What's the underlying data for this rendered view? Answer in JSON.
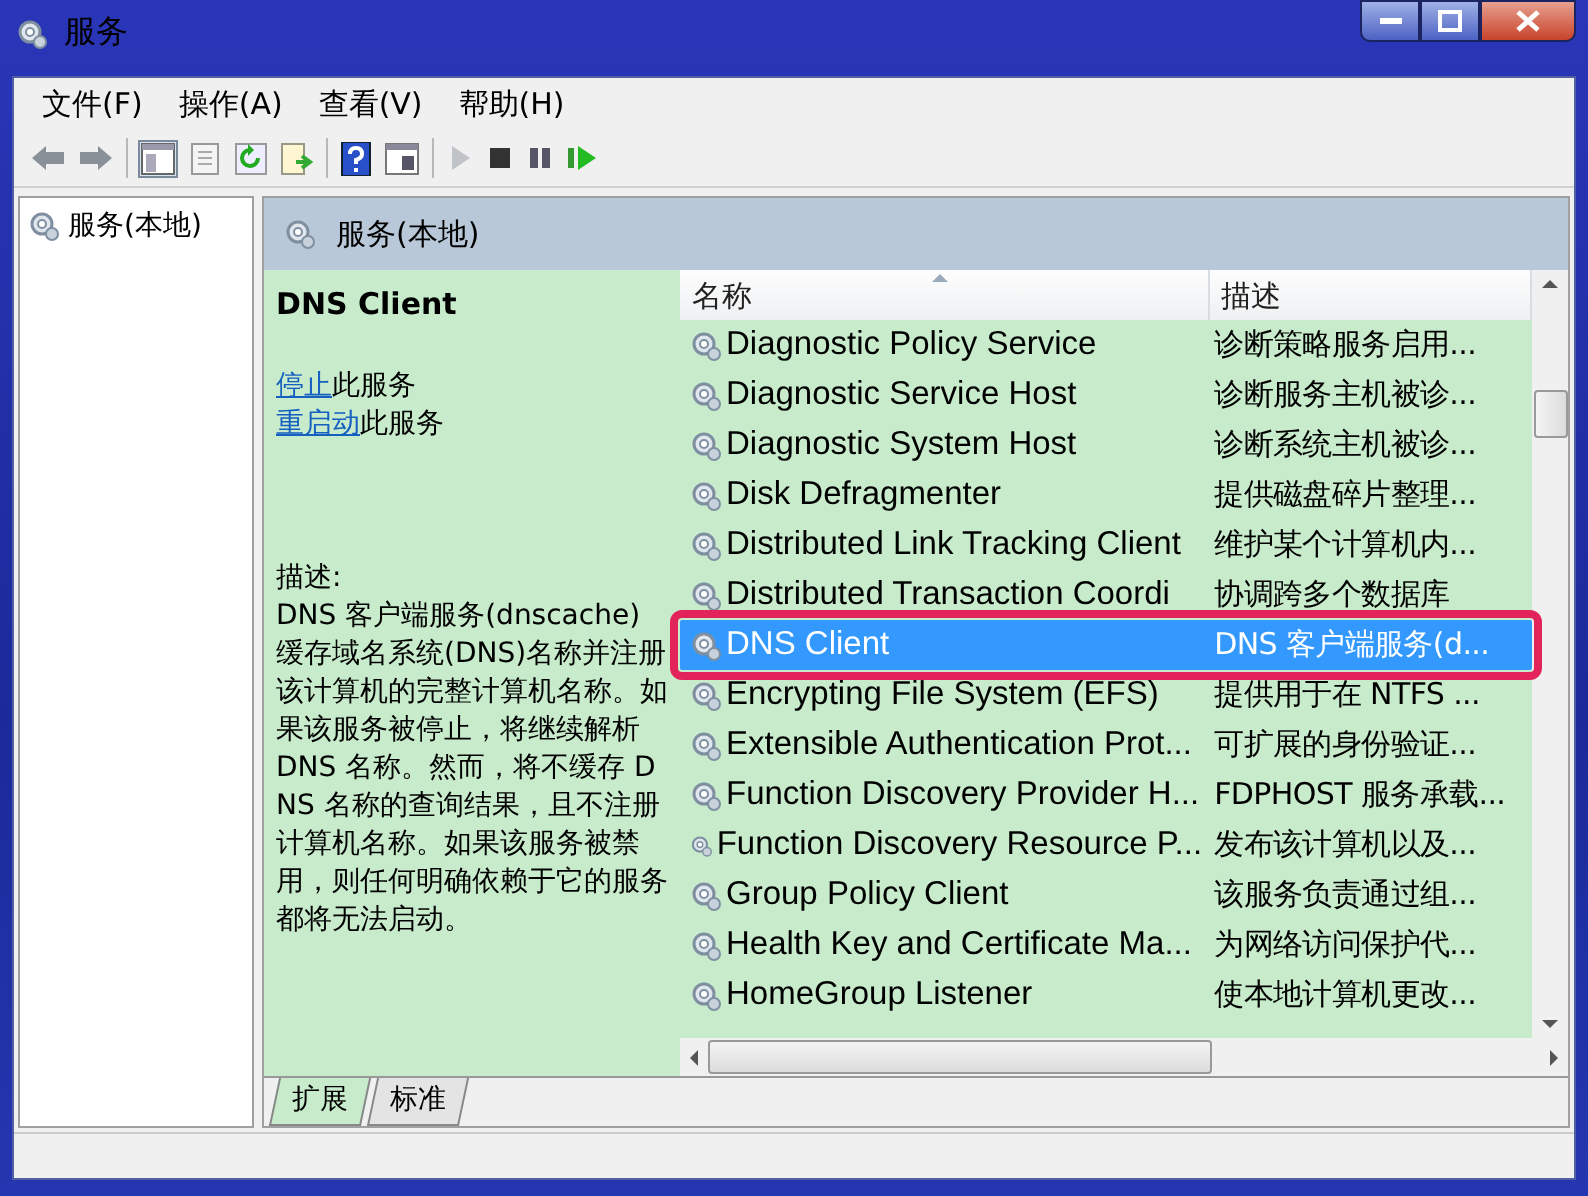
{
  "window": {
    "title": "服务"
  },
  "menu": [
    {
      "label": "文件(F)"
    },
    {
      "label": "操作(A)"
    },
    {
      "label": "查看(V)"
    },
    {
      "label": "帮助(H)"
    }
  ],
  "tree": {
    "items": [
      {
        "label": "服务(本地)",
        "selected": false
      }
    ]
  },
  "pane_header": {
    "title": "服务(本地)"
  },
  "detail": {
    "title": "DNS Client",
    "actions": [
      {
        "link": "停止",
        "text": "此服务"
      },
      {
        "link": "重启动",
        "text": "此服务"
      }
    ],
    "description_label": "描述:",
    "description": "DNS 客户端服务(dnscache)缓存域名系统(DNS)名称并注册该计算机的完整计算机名称。如果该服务被停止，将继续解析 DNS 名称。然而，将不缓存 DNS 名称的查询结果，且不注册计算机名称。如果该服务被禁用，则任何明确依赖于它的服务都将无法启动。"
  },
  "table": {
    "columns": [
      {
        "label": "名称",
        "sorted": true
      },
      {
        "label": "描述",
        "sorted": false
      }
    ],
    "rows": [
      {
        "name": "Diagnostic Policy Service",
        "description": "诊断策略服务启用...",
        "selected": false
      },
      {
        "name": "Diagnostic Service Host",
        "description": "诊断服务主机被诊...",
        "selected": false
      },
      {
        "name": "Diagnostic System Host",
        "description": "诊断系统主机被诊...",
        "selected": false
      },
      {
        "name": "Disk Defragmenter",
        "description": "提供磁盘碎片整理...",
        "selected": false
      },
      {
        "name": "Distributed Link Tracking Client",
        "description": "维护某个计算机内...",
        "selected": false
      },
      {
        "name": "Distributed Transaction Coordi",
        "description": "协调跨多个数据库",
        "selected": false
      },
      {
        "name": "DNS Client",
        "description": "DNS 客户端服务(d...",
        "selected": true
      },
      {
        "name": "Encrypting File System (EFS)",
        "description": "提供用于在 NTFS ...",
        "selected": false
      },
      {
        "name": "Extensible Authentication Prot...",
        "description": "可扩展的身份验证...",
        "selected": false
      },
      {
        "name": "Function Discovery Provider H...",
        "description": "FDPHOST 服务承载...",
        "selected": false
      },
      {
        "name": "Function Discovery Resource P...",
        "description": "发布该计算机以及...",
        "selected": false
      },
      {
        "name": "Group Policy Client",
        "description": "该服务负责通过组...",
        "selected": false
      },
      {
        "name": "Health Key and Certificate Ma...",
        "description": "为网络访问保护代...",
        "selected": false
      },
      {
        "name": "HomeGroup Listener",
        "description": "使本地计算机更改...",
        "selected": false
      }
    ]
  },
  "tabs": [
    {
      "label": "扩展",
      "selected": true
    },
    {
      "label": "标准",
      "selected": false
    }
  ]
}
